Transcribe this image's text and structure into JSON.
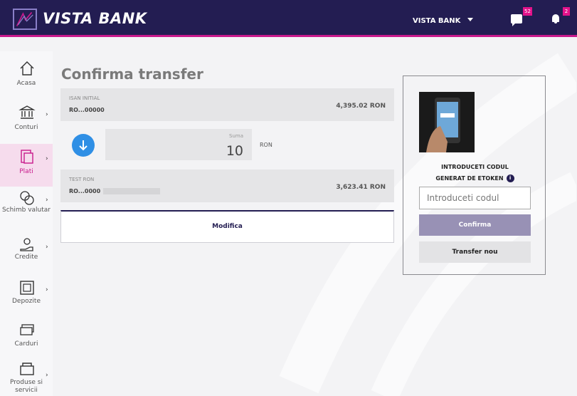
{
  "header": {
    "brand": "VISTA BANK",
    "account_selector": "VISTA BANK",
    "messages_badge": "52",
    "notifications_badge": "2"
  },
  "sidebar": {
    "items": [
      {
        "label": "Acasa",
        "icon": "home-icon",
        "active": false
      },
      {
        "label": "Conturi",
        "icon": "bank-icon",
        "active": false
      },
      {
        "label": "Plati",
        "icon": "payment-icon",
        "active": true
      },
      {
        "label": "Schimb valutar",
        "icon": "exchange-icon",
        "active": false
      },
      {
        "label": "Credite",
        "icon": "credit-icon",
        "active": false
      },
      {
        "label": "Depozite",
        "icon": "deposit-icon",
        "active": false
      },
      {
        "label": "Carduri",
        "icon": "card-icon",
        "active": false
      },
      {
        "label": "Produse si servicii",
        "icon": "products-icon",
        "active": false
      }
    ]
  },
  "main": {
    "title": "Confirma transfer",
    "source": {
      "label": "ISAN INITIAL",
      "account": "RO...00000",
      "balance": "4,395.02 RON"
    },
    "amount": {
      "label": "Suma",
      "value": "10",
      "currency": "RON"
    },
    "destination": {
      "label": "TEST RON",
      "account": "RO...0000",
      "balance": "3,623.41 RON"
    },
    "modify_label": "Modifica"
  },
  "confirm_panel": {
    "instruction_line1": "INTRODUCETI CODUL",
    "instruction_line2": "GENERAT DE ETOKEN",
    "info_icon": "i",
    "code_placeholder": "Introduceti codul",
    "confirm_label": "Confirma",
    "new_transfer_label": "Transfer nou"
  },
  "colors": {
    "header_bg": "#231d52",
    "accent": "#c8198c",
    "confirm_button": "#9891b5",
    "arrow_button": "#2f8fe5"
  }
}
